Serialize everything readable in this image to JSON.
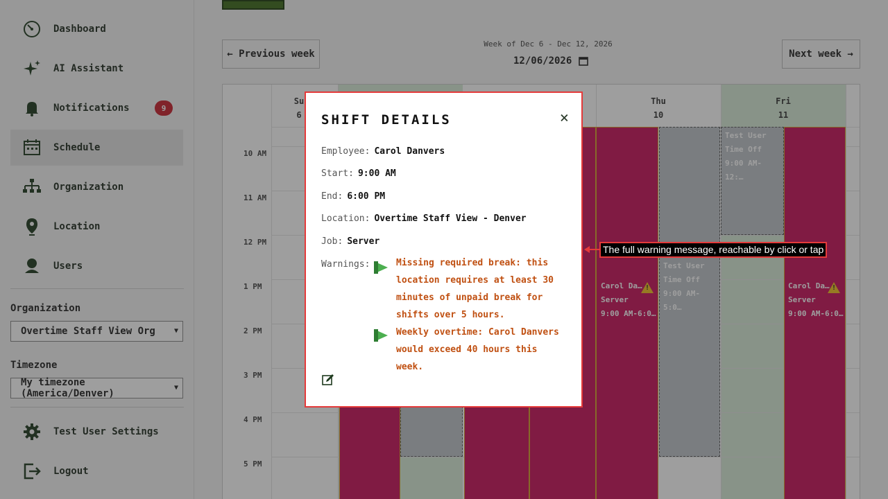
{
  "sidebar": {
    "items": [
      {
        "label": "Dashboard",
        "icon": "dashboard-icon"
      },
      {
        "label": "AI Assistant",
        "icon": "sparkle-icon"
      },
      {
        "label": "Notifications",
        "icon": "bell-icon",
        "badge": "9"
      },
      {
        "label": "Schedule",
        "icon": "calendar-icon",
        "active": true
      },
      {
        "label": "Organization",
        "icon": "org-chart-icon"
      },
      {
        "label": "Location",
        "icon": "map-pin-icon"
      },
      {
        "label": "Users",
        "icon": "user-icon"
      }
    ],
    "organization_label": "Organization",
    "organization_value": "Overtime Staff View Org",
    "timezone_label": "Timezone",
    "timezone_value": "My timezone (America/Denver)",
    "settings_label": "Test User Settings",
    "logout_label": "Logout"
  },
  "schedule": {
    "prev_label": "← Previous week",
    "next_label": "Next week →",
    "week_label": "Week of Dec 6 - Dec 12, 2026",
    "week_date": "12/06/2026",
    "hours": [
      "10 AM",
      "11 AM",
      "12 PM",
      "1 PM",
      "2 PM",
      "3 PM",
      "4 PM",
      "5 PM"
    ],
    "columns": [
      {
        "day": "Su",
        "date": "6"
      },
      {
        "day": "Thu",
        "date": "10"
      },
      {
        "day": "Fri",
        "date": "11"
      }
    ],
    "ghost_shifts": [
      {
        "name": "Test User",
        "type": "Time Off",
        "time": "9:00 AM-12:…"
      },
      {
        "name": "Test User",
        "type": "Time Off",
        "time": "9:00 AM-5:0…"
      }
    ],
    "shifts": [
      {
        "name": "Carol Da…",
        "role": "Server",
        "time": "9:00 AM-6:0…"
      },
      {
        "name": "Carol Da…",
        "role": "Server",
        "time": "9:00 AM-6:0…"
      }
    ],
    "colors": {
      "shift": "#c8125a",
      "ghost": "#bec3c8",
      "tint": "#d8ecd8"
    }
  },
  "modal": {
    "title": "SHIFT DETAILS",
    "close": "×",
    "employee_label": "Employee:",
    "employee": "Carol Danvers",
    "start_label": "Start:",
    "start": "9:00 AM",
    "end_label": "End:",
    "end": "6:00 PM",
    "location_label": "Location:",
    "location": "Overtime Staff View - Denver",
    "job_label": "Job:",
    "job": "Server",
    "warnings_label": "Warnings:",
    "warnings": [
      "Missing required break: this location requires at least 30 minutes of unpaid break for shifts over 5 hours.",
      "Weekly overtime: Carol Danvers would exceed 40 hours this week."
    ],
    "edit_icon": "edit-icon"
  },
  "callout": {
    "text": "The full warning message, reachable by click or tap"
  }
}
